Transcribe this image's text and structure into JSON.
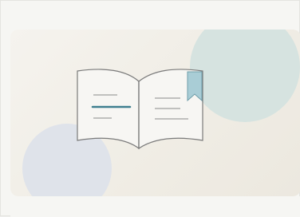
{
  "illustration": {
    "subject": "open-book-with-bookmark",
    "colors": {
      "background": "#f6f6f3",
      "card": "#f1eee7",
      "circle_teal": "#d6e3e0",
      "circle_blue": "#dfe3ea",
      "page_fill": "#f7f6f3",
      "outline": "#7a7a7a",
      "accent_line": "#3f7f8f",
      "bookmark": "#a9cdd6"
    }
  }
}
